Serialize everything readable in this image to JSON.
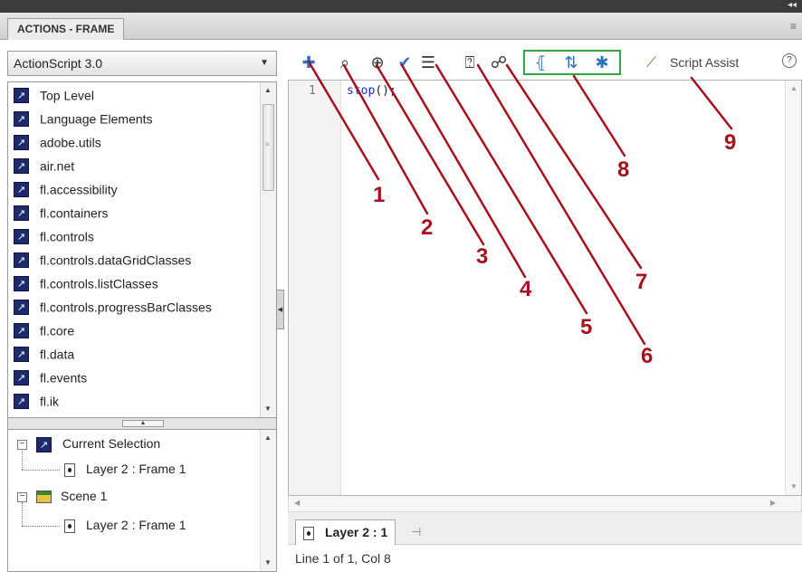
{
  "panel": {
    "title": "ACTIONS - FRAME"
  },
  "language_dropdown": {
    "value": "ActionScript 3.0"
  },
  "toolbox": {
    "items": [
      "Top Level",
      "Language Elements",
      "adobe.utils",
      "air.net",
      "fl.accessibility",
      "fl.containers",
      "fl.controls",
      "fl.controls.dataGridClasses",
      "fl.controls.listClasses",
      "fl.controls.progressBarClasses",
      "fl.core",
      "fl.data",
      "fl.events",
      "fl.ik"
    ]
  },
  "script_navigator": {
    "current_selection": "Current Selection",
    "current_frame": "Layer 2 : Frame 1",
    "scene": "Scene 1",
    "scene_frame": "Layer 2 : Frame 1"
  },
  "toolbar": {
    "script_assist": "Script Assist",
    "help": "?",
    "icons": [
      "add-new-item-icon",
      "find-icon",
      "insert-target-path-icon",
      "check-syntax-icon",
      "auto-format-icon",
      "show-code-hint-icon",
      "debug-options-icon",
      "collapse-between-braces-icon",
      "collapse-selection-icon",
      "expand-all-icon",
      "script-assist-wand-icon"
    ]
  },
  "editor": {
    "line_number": "1",
    "code_keyword": "stop",
    "code_rest": "();"
  },
  "tab": {
    "label": "Layer 2 : 1"
  },
  "status": {
    "text": "Line 1 of 1, Col 8"
  },
  "callouts": [
    "1",
    "2",
    "3",
    "4",
    "5",
    "6",
    "7",
    "8",
    "9"
  ],
  "colors": {
    "annotation_red": "#a8101c",
    "highlight_green": "#2eaa3f",
    "book_icon": "#1d2a6b",
    "keyword_blue": "#1b2fb5"
  }
}
